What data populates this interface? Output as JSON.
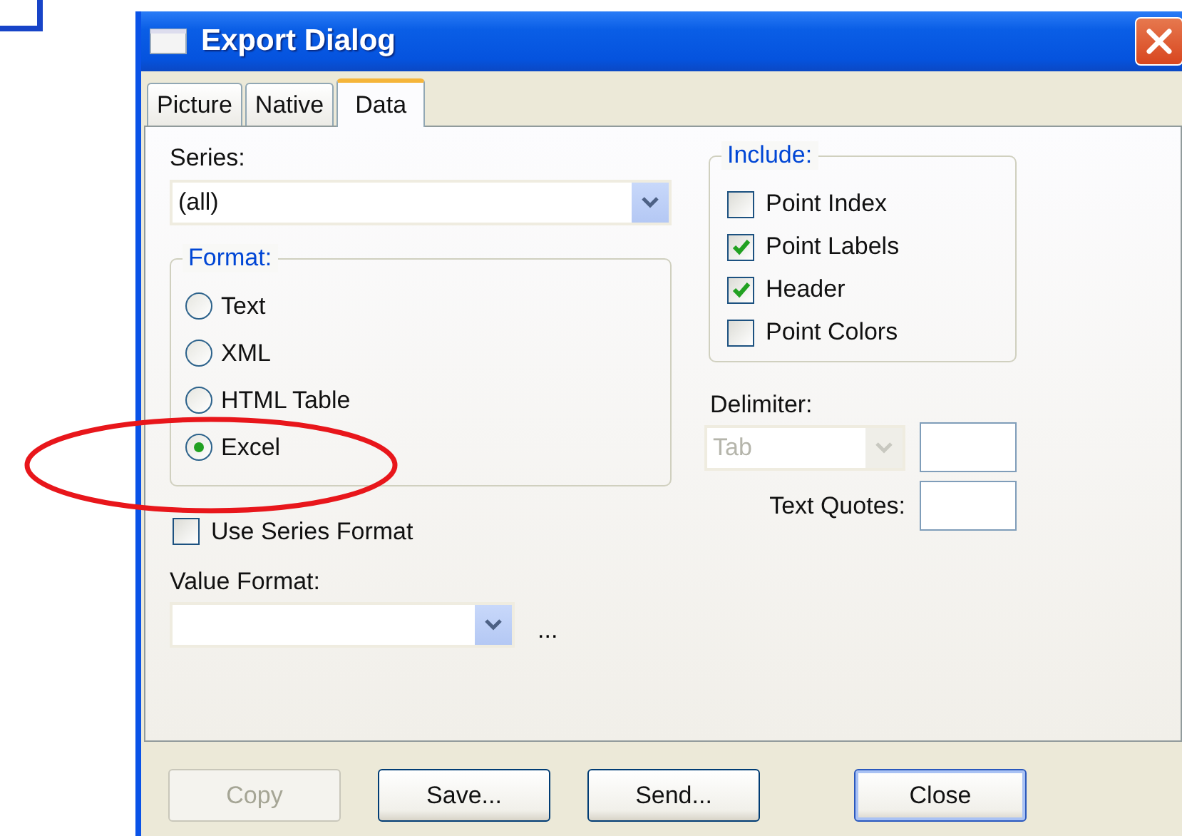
{
  "window": {
    "title": "Export Dialog"
  },
  "tabs": [
    {
      "label": "Picture",
      "selected": false
    },
    {
      "label": "Native",
      "selected": false
    },
    {
      "label": "Data",
      "selected": true
    }
  ],
  "series": {
    "label": "Series:",
    "value": "(all)"
  },
  "format": {
    "legend": "Format:",
    "options": [
      {
        "label": "Text",
        "selected": false
      },
      {
        "label": "XML",
        "selected": false
      },
      {
        "label": "HTML Table",
        "selected": false
      },
      {
        "label": "Excel",
        "selected": true
      }
    ]
  },
  "use_series_format": {
    "label": "Use Series Format",
    "checked": false
  },
  "value_format": {
    "label": "Value Format:",
    "more": "..."
  },
  "include": {
    "legend": "Include:",
    "options": [
      {
        "label": "Point Index",
        "checked": false
      },
      {
        "label": "Point Labels",
        "checked": true
      },
      {
        "label": "Header",
        "checked": true
      },
      {
        "label": "Point Colors",
        "checked": false
      }
    ]
  },
  "delimiter": {
    "label": "Delimiter:",
    "value": "Tab",
    "disabled": true
  },
  "text_quotes": {
    "label": "Text Quotes:"
  },
  "buttons": [
    {
      "label": "Copy",
      "disabled": true
    },
    {
      "label": "Save...",
      "disabled": false
    },
    {
      "label": "Send...",
      "disabled": false
    },
    {
      "label": "Close",
      "disabled": false
    }
  ]
}
